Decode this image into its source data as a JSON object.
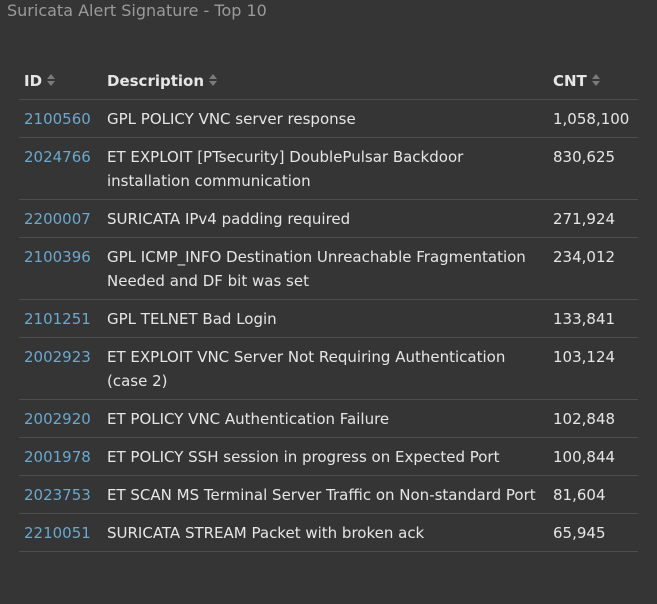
{
  "panel": {
    "title": "Suricata Alert Signature - Top 10"
  },
  "table": {
    "columns": [
      {
        "label": "ID"
      },
      {
        "label": "Description"
      },
      {
        "label": "CNT"
      }
    ],
    "rows": [
      {
        "id": "2100560",
        "description": "GPL POLICY VNC server response",
        "cnt": "1,058,100"
      },
      {
        "id": "2024766",
        "description": "ET EXPLOIT [PTsecurity] DoublePulsar Backdoor installation communication",
        "cnt": "830,625"
      },
      {
        "id": "2200007",
        "description": "SURICATA IPv4 padding required",
        "cnt": "271,924"
      },
      {
        "id": "2100396",
        "description": "GPL ICMP_INFO Destination Unreachable Fragmentation Needed and DF bit was set",
        "cnt": "234,012"
      },
      {
        "id": "2101251",
        "description": "GPL TELNET Bad Login",
        "cnt": "133,841"
      },
      {
        "id": "2002923",
        "description": "ET EXPLOIT VNC Server Not Requiring Authentication (case 2)",
        "cnt": "103,124"
      },
      {
        "id": "2002920",
        "description": "ET POLICY VNC Authentication Failure",
        "cnt": "102,848"
      },
      {
        "id": "2001978",
        "description": "ET POLICY SSH session in progress on Expected Port",
        "cnt": "100,844"
      },
      {
        "id": "2023753",
        "description": "ET SCAN MS Terminal Server Traffic on Non-standard Port",
        "cnt": "81,604"
      },
      {
        "id": "2210051",
        "description": "SURICATA STREAM Packet with broken ack",
        "cnt": "65,945"
      }
    ]
  },
  "icons": {
    "sort": "sort-icon"
  },
  "colors": {
    "background": "#353535",
    "title": "#9a9a9a",
    "text": "#e6e6e6",
    "link": "#6aa8cf",
    "divider": "#4d4d4d"
  }
}
